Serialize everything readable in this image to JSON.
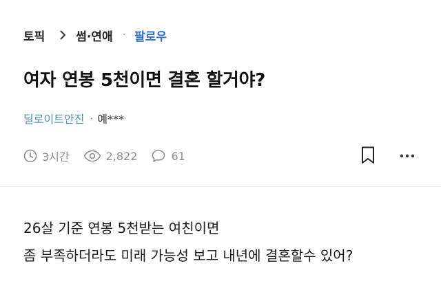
{
  "breadcrumb": {
    "topic": "토픽",
    "category": "썸·연애",
    "separator_dot": "·",
    "follow": "팔로우"
  },
  "post": {
    "title": "여자 연봉 5천이면 결혼 할거야?",
    "company": "딜로이트안진",
    "meta_dot": "·",
    "author": "예***",
    "time": "3시간",
    "views": "2,822",
    "comments": "61",
    "body_lines": [
      "26살 기준 연봉 5천받는 여친이면",
      "좀 부족하더라도 미래 가능성 보고 내년에 결혼할수 있어?"
    ]
  },
  "icons": {
    "chevron": "chevron-right-icon",
    "time": "clock-icon",
    "views": "eye-icon",
    "comments": "comment-bubble-icon",
    "bookmark": "bookmark-icon",
    "more": "more-horizontal-icon"
  },
  "colors": {
    "follow": "#2f6fd6",
    "company": "#4d8fa0",
    "stats": "#8a8f96"
  }
}
